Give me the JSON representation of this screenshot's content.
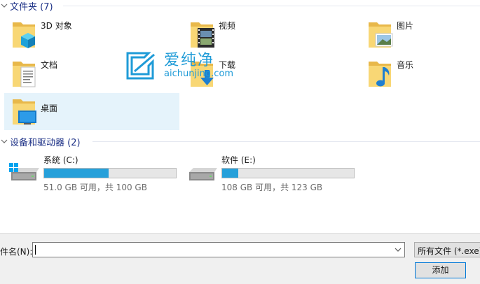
{
  "groups": {
    "folders_title": "文件夹 (7)",
    "drives_title": "设备和驱动器 (2)"
  },
  "folders": [
    {
      "label": "3D 对象",
      "icon": "3d-objects-folder-icon"
    },
    {
      "label": "视频",
      "icon": "videos-folder-icon"
    },
    {
      "label": "图片",
      "icon": "pictures-folder-icon"
    },
    {
      "label": "文档",
      "icon": "documents-folder-icon"
    },
    {
      "label": "下载",
      "icon": "downloads-folder-icon"
    },
    {
      "label": "音乐",
      "icon": "music-folder-icon"
    },
    {
      "label": "桌面",
      "icon": "desktop-folder-icon",
      "selected": true
    }
  ],
  "drives": [
    {
      "name": "系统 (C:)",
      "free_text": "51.0 GB 可用，共 100 GB",
      "used_fraction": 0.49,
      "icon": "windows-drive-icon"
    },
    {
      "name": "软件 (E:)",
      "free_text": "108 GB 可用，共 123 GB",
      "used_fraction": 0.12,
      "icon": "drive-icon"
    }
  ],
  "bottom": {
    "filename_label": "件名(N):",
    "filename_value": "",
    "filter_label": "所有文件 (*.exe)",
    "add_button": "添加"
  },
  "watermark": {
    "cn": "爱纯净",
    "url": "aichunjing.com"
  },
  "colors": {
    "accent": "#26a0da",
    "header_text": "#1e3287",
    "selection": "#e5f3fb",
    "folder": "#f8d775"
  }
}
